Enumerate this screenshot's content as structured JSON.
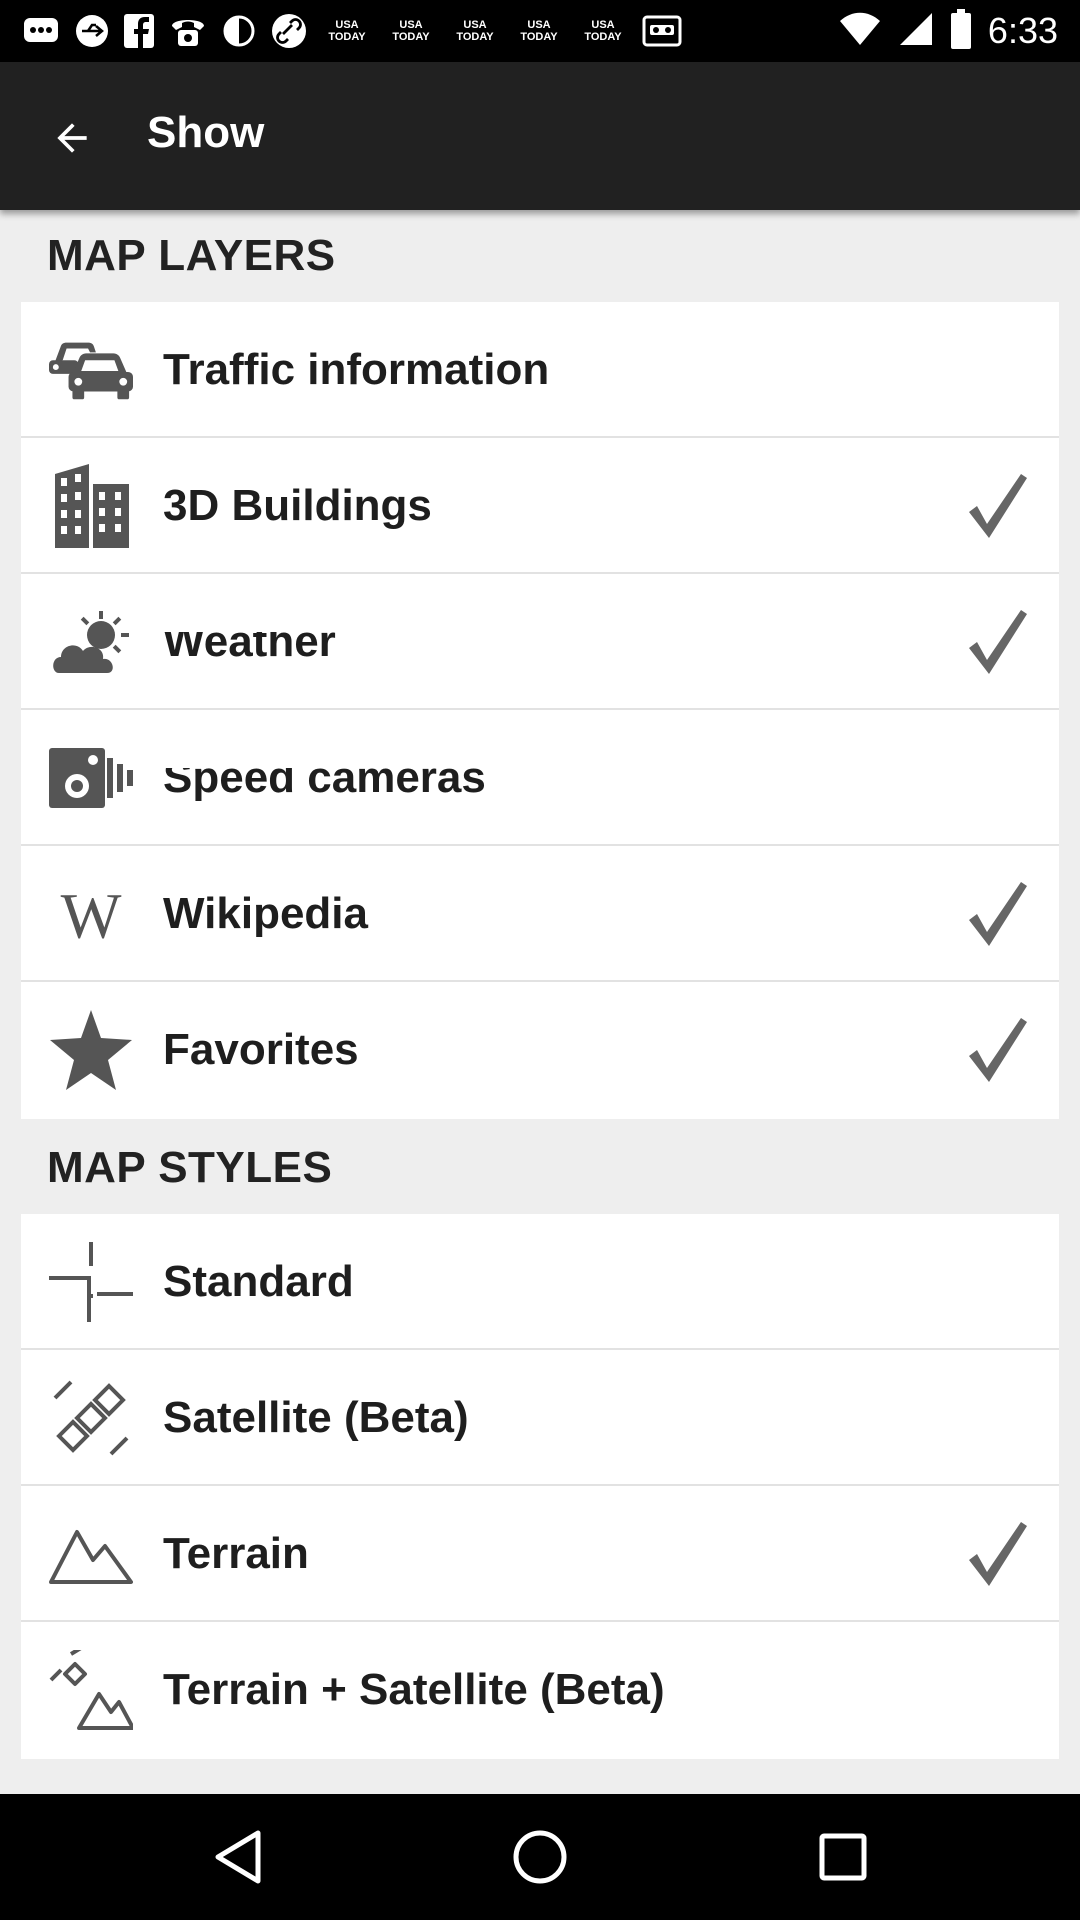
{
  "status_bar": {
    "time": "6:33",
    "news_icon_text": [
      "USA",
      "TODAY"
    ],
    "notification_icons": [
      "messages-icon",
      "usb-icon",
      "facebook-icon",
      "phone-icon",
      "contrast-icon",
      "link-icon",
      "usa-today-icon",
      "usa-today-icon",
      "usa-today-icon",
      "usa-today-icon",
      "usa-today-icon",
      "voicemail-icon"
    ],
    "system_icons": [
      "wifi-icon",
      "signal-icon",
      "battery-icon"
    ]
  },
  "app_bar": {
    "title": "Show",
    "back_icon": "arrow-back-icon"
  },
  "map_layers": {
    "header": "MAP LAYERS",
    "items": [
      {
        "label": "Traffic information",
        "icon": "traffic-cars-icon",
        "checked": false
      },
      {
        "label": "3D Buildings",
        "icon": "buildings-icon",
        "checked": true
      },
      {
        "label": "Weather",
        "icon": "weather-icon",
        "checked": true
      },
      {
        "label": "Speed cameras",
        "icon": "speed-camera-icon",
        "checked": false
      },
      {
        "label": "Wikipedia",
        "icon": "wikipedia-icon",
        "checked": true
      },
      {
        "label": "Favorites",
        "icon": "star-icon",
        "checked": true
      }
    ]
  },
  "map_styles": {
    "header": "MAP STYLES",
    "items": [
      {
        "label": "Standard",
        "icon": "road-junction-icon",
        "checked": false
      },
      {
        "label": "Satellite (Beta)",
        "icon": "satellite-icon",
        "checked": false
      },
      {
        "label": "Terrain",
        "icon": "mountain-icon",
        "checked": true
      },
      {
        "label": "Terrain + Satellite (Beta)",
        "icon": "satellite-mountain-icon",
        "checked": false
      }
    ]
  },
  "nav_bar": {
    "buttons": [
      "back-triangle-icon",
      "home-circle-icon",
      "recents-square-icon"
    ]
  },
  "colors": {
    "app_bar": "#212121",
    "background": "#eeeeee",
    "card": "#ffffff",
    "icon_gray": "#555555",
    "check_gray": "#666666"
  }
}
